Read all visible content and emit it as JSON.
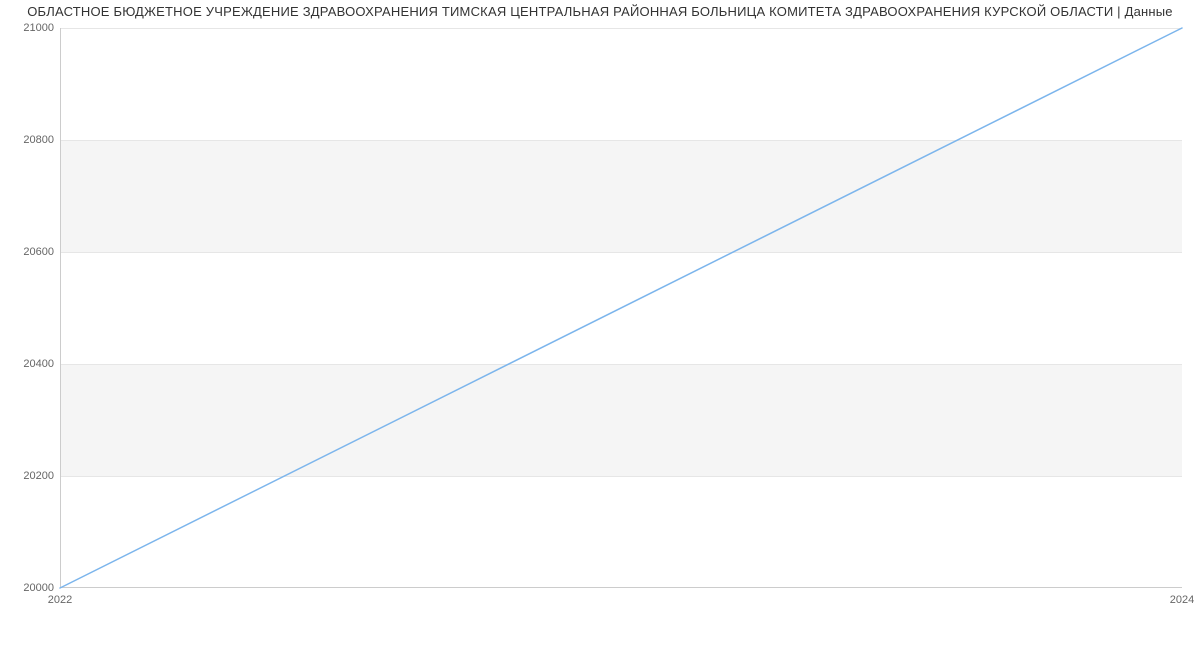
{
  "chart_data": {
    "type": "line",
    "title": "ОБЛАСТНОЕ БЮДЖЕТНОЕ УЧРЕЖДЕНИЕ ЗДРАВООХРАНЕНИЯ ТИМСКАЯ ЦЕНТРАЛЬНАЯ РАЙОННАЯ БОЛЬНИЦА КОМИТЕТА ЗДРАВООХРАНЕНИЯ КУРСКОЙ ОБЛАСТИ | Данные",
    "x": [
      2022,
      2024
    ],
    "series": [
      {
        "name": "Данные",
        "values": [
          20000,
          21000
        ],
        "color": "#7cb5ec"
      }
    ],
    "xlabel": "",
    "ylabel": "",
    "xticks": [
      2022,
      2024
    ],
    "yticks": [
      20000,
      20200,
      20400,
      20600,
      20800,
      21000
    ],
    "bands": [
      [
        20200,
        20400
      ],
      [
        20600,
        20800
      ]
    ],
    "xlim": [
      2022,
      2024
    ],
    "ylim": [
      20000,
      21000
    ]
  }
}
